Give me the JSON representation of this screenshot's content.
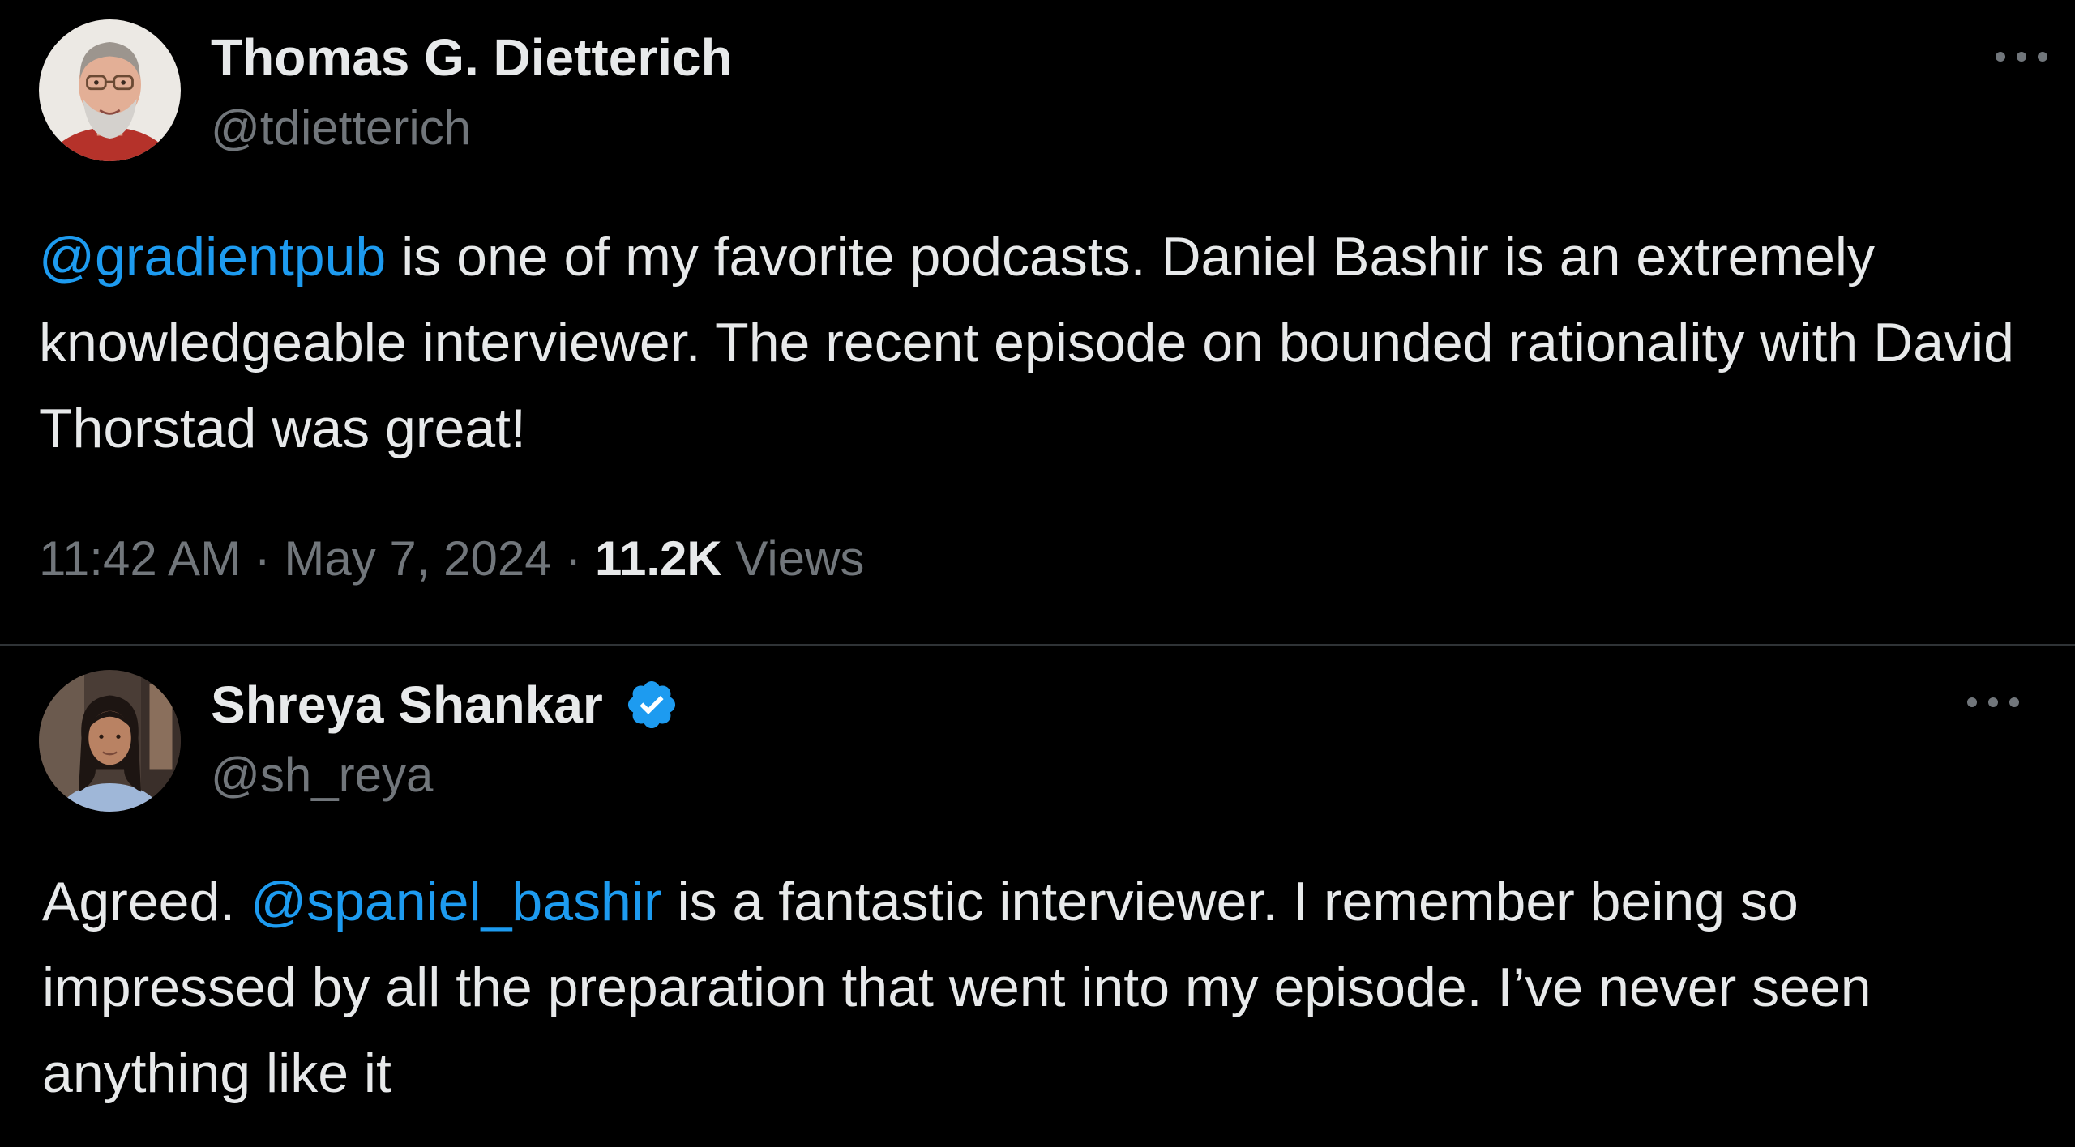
{
  "tweets": [
    {
      "author": {
        "display_name": "Thomas G. Dietterich",
        "handle": "@tdietterich",
        "verified": false
      },
      "text": {
        "mention": "@gradientpub",
        "after_mention": " is one of my favorite podcasts. Daniel Bashir is an extremely knowledgeable interviewer. The recent episode on bounded rationality with David Thorstad was great!"
      },
      "meta": {
        "time": "11:42 AM",
        "separator": " · ",
        "date": "May 7, 2024",
        "views_count": "11.2K",
        "views_label": " Views"
      },
      "menu_icon": "more-horizontal-icon"
    },
    {
      "author": {
        "display_name": "Shreya Shankar",
        "handle": "@sh_reya",
        "verified": true
      },
      "text": {
        "before_mention": "Agreed. ",
        "mention": "@spaniel_bashir",
        "after_mention": " is a fantastic interviewer. I remember being so impressed by all the preparation that went into my episode. I’ve never seen anything like it"
      },
      "menu_icon": "more-horizontal-icon"
    }
  ],
  "colors": {
    "background": "#000000",
    "primary_text": "#e7e9ea",
    "secondary_text": "#71767b",
    "link": "#1d9bf0",
    "divider": "#2f3336"
  }
}
